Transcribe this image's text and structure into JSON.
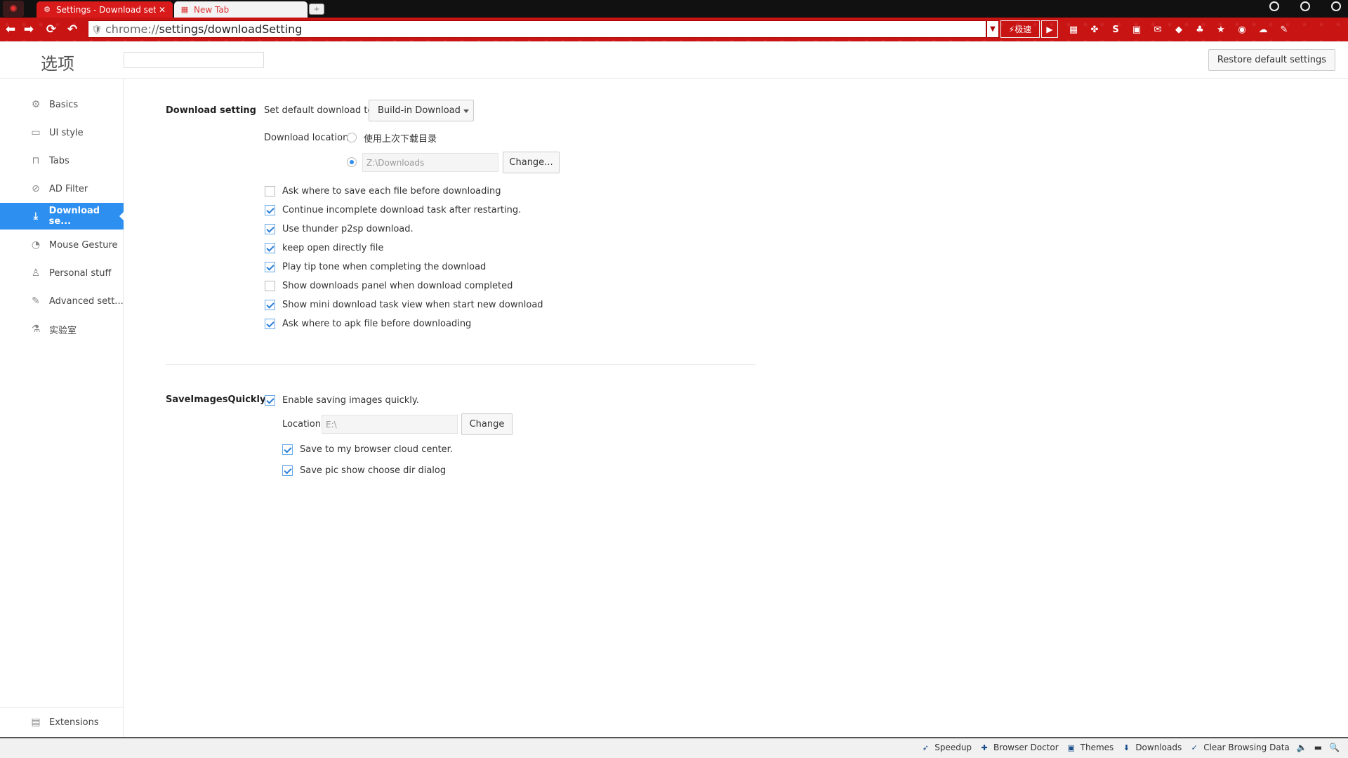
{
  "browser": {
    "tabs": [
      {
        "title": "Settings - Download settir",
        "active": true
      },
      {
        "title": "New Tab",
        "active": false
      }
    ],
    "url_scheme": "chrome://",
    "url_path": "settings/downloadSetting",
    "speed_label": "⚡极速",
    "accent_color": "#c91414"
  },
  "header": {
    "title": "选项",
    "search_placeholder": "",
    "restore_label": "Restore default settings"
  },
  "sidebar": {
    "items": [
      {
        "label": "Basics",
        "icon": "gear-icon"
      },
      {
        "label": "UI style",
        "icon": "window-icon"
      },
      {
        "label": "Tabs",
        "icon": "tab-icon"
      },
      {
        "label": "AD Filter",
        "icon": "block-icon"
      },
      {
        "label": "Download se...",
        "icon": "download-icon",
        "active": true
      },
      {
        "label": "Mouse Gesture",
        "icon": "mouse-icon"
      },
      {
        "label": "Personal stuff",
        "icon": "person-icon"
      },
      {
        "label": "Advanced sett...",
        "icon": "wrench-icon"
      },
      {
        "label": "实验室",
        "icon": "flask-icon"
      }
    ],
    "extensions_label": "Extensions",
    "active_color": "#2d8ff0"
  },
  "download": {
    "section_title": "Download setting",
    "default_label": "Set default download to:",
    "default_value": "Build-in Download",
    "location_label": "Download location:",
    "location_option_last": "使用上次下载目录",
    "location_path": "Z:\\Downloads",
    "change_label": "Change...",
    "options": [
      {
        "label": "Ask where to save each file before downloading",
        "checked": false
      },
      {
        "label": "Continue incomplete download task after restarting.",
        "checked": true
      },
      {
        "label": "Use thunder p2sp download.",
        "checked": true
      },
      {
        "label": "keep open directly file",
        "checked": true
      },
      {
        "label": "Play tip tone when completing the download",
        "checked": true
      },
      {
        "label": "Show downloads panel when download completed",
        "checked": false
      },
      {
        "label": "Show mini download task view when start new download",
        "checked": true
      },
      {
        "label": "Ask where to apk file before downloading",
        "checked": true
      }
    ]
  },
  "save_images": {
    "section_title": "SaveImagesQuickly",
    "enable_label": "Enable saving images quickly.",
    "enable_checked": true,
    "location_label": "Location:",
    "location_value": "E:\\",
    "change_label": "Change",
    "options": [
      {
        "label": "Save to my browser cloud center.",
        "checked": true
      },
      {
        "label": "Save pic show choose dir dialog",
        "checked": true
      }
    ]
  },
  "statusbar": {
    "items": [
      {
        "label": "Speedup",
        "icon": "rocket-icon"
      },
      {
        "label": "Browser Doctor",
        "icon": "doctor-icon"
      },
      {
        "label": "Themes",
        "icon": "themes-icon"
      },
      {
        "label": "Downloads",
        "icon": "download-icon"
      },
      {
        "label": "Clear Browsing Data",
        "icon": "broom-icon"
      }
    ]
  }
}
